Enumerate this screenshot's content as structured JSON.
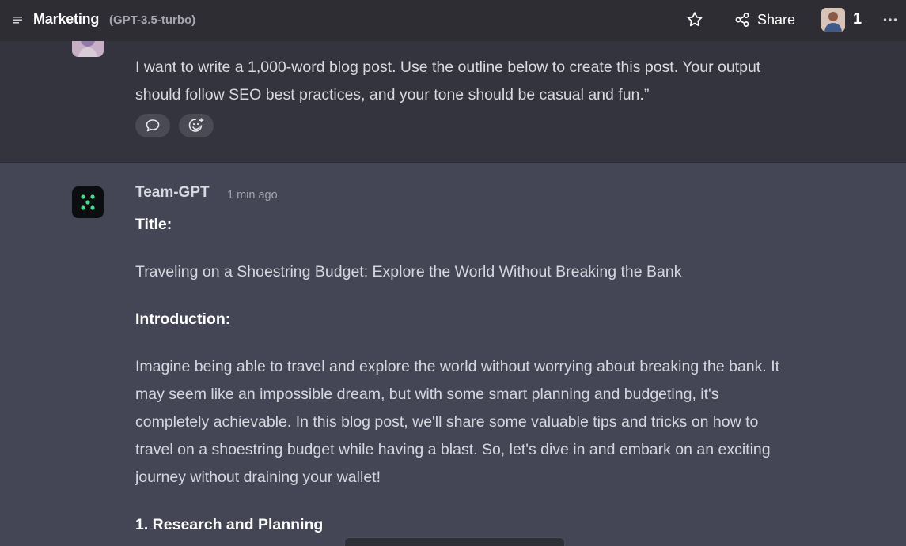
{
  "header": {
    "title": "Marketing",
    "model": "(GPT-3.5-turbo)",
    "share_label": "Share",
    "user_count": "1",
    "icons": [
      "menu-icon",
      "star-icon",
      "share-icon",
      "more-icon"
    ]
  },
  "user_message": {
    "text": "I want to write a 1,000-word blog post. Use the outline below to create this post. Your output should follow SEO best practices, and your tone should be casual and fun.”",
    "actions": [
      "comment-icon",
      "add-reaction-icon"
    ]
  },
  "assistant_message": {
    "author": "Team-GPT",
    "time": "1 min ago",
    "title_heading": "Title:",
    "title_text": "Traveling on a Shoestring Budget: Explore the World Without Breaking the Bank",
    "intro_heading": "Introduction:",
    "intro_text": "Imagine being able to travel and explore the world without worrying about breaking the bank. It may seem like an impossible dream, but with some smart planning and budgeting, it's completely achievable. In this blog post, we'll share some valuable tips and tricks on how to travel on a shoestring budget while having a blast. So, let's dive in and embark on an exciting journey without draining your wallet!",
    "section1_heading": "1. Research and Planning"
  },
  "colors": {
    "page_bg": "#454655",
    "header_bg": "#2d2d33",
    "user_section_bg": "#34343f",
    "accent_green": "#3ee08f"
  }
}
